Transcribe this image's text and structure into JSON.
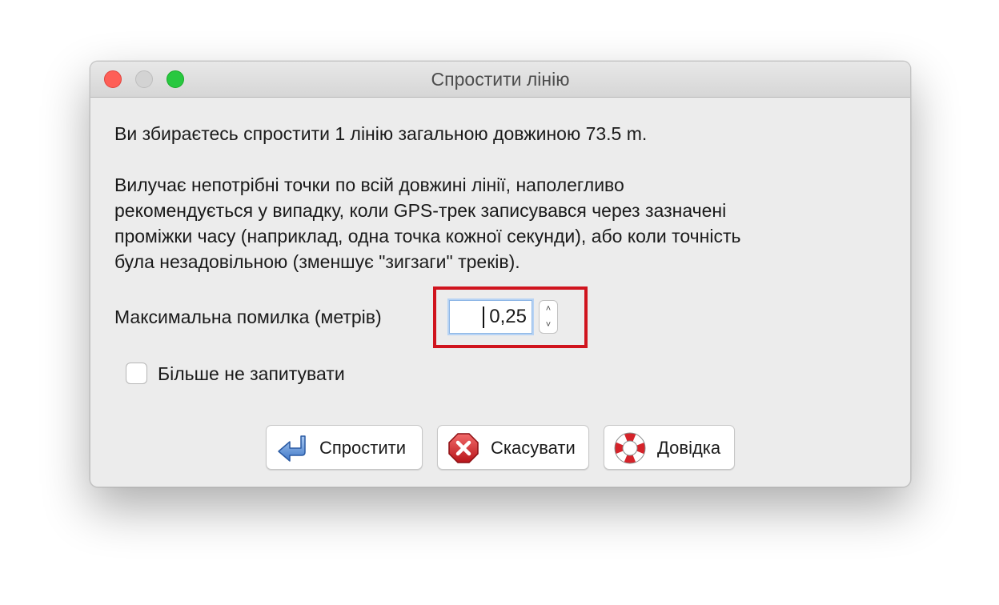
{
  "window": {
    "title": "Спростити лінію"
  },
  "message": {
    "summary": "Ви збираєтесь спростити 1 лінію загальною довжиною 73.5 m.",
    "description_lines": [
      "Вилучає непотрібні точки по всій довжині лінії, наполегливо",
      "рекомендується у випадку, коли GPS-трек записувався через зазначені",
      "проміжки часу (наприклад, одна точка кожної секунди), або коли точність",
      "була незадовільною (зменшує \"зигзаги\" треків)."
    ]
  },
  "max_error": {
    "label": "Максимальна помилка (метрів)",
    "value": "0,25"
  },
  "dont_ask": {
    "label": "Більше не запитувати",
    "checked": false
  },
  "buttons": {
    "simplify": "Спростити",
    "cancel": "Скасувати",
    "help": "Довідка"
  },
  "icons": {
    "simplify": "blue-return-arrow-icon",
    "cancel": "red-stop-x-icon",
    "help": "lifebuoy-icon"
  },
  "colors": {
    "highlight": "#d0141e",
    "close": "#fe5f57",
    "zoom": "#28c840",
    "focus_ring": "#8fb7e6"
  }
}
